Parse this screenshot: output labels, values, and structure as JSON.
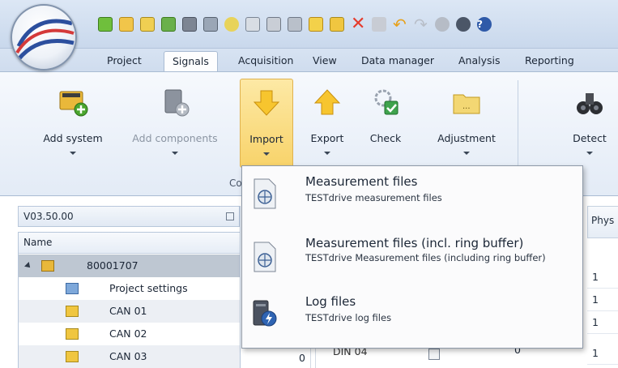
{
  "tabs": [
    "Project",
    "Signals",
    "Acquisition",
    "View",
    "Data manager",
    "Analysis",
    "Reporting"
  ],
  "active_tab": "Signals",
  "ribbon": {
    "add_system": "Add system",
    "add_components": "Add components",
    "import": "Import",
    "export": "Export",
    "check": "Check",
    "adjustment": "Adjustment",
    "detect": "Detect",
    "group_label": "Co"
  },
  "version": "V03.50.00",
  "tree": {
    "header": "Name",
    "rows": [
      {
        "label": "80001707"
      },
      {
        "label": "Project settings"
      },
      {
        "label": "CAN 01"
      },
      {
        "label": "CAN 02"
      },
      {
        "label": "CAN 03"
      }
    ]
  },
  "grid": {
    "phys_header": "Phys",
    "values": [
      "1",
      "1",
      "1",
      "1"
    ],
    "last_row": {
      "count": "0",
      "name": "DIN 04",
      "value": "0"
    }
  },
  "import_menu": {
    "items": [
      {
        "title": "Measurement files",
        "subtitle": "TESTdrive measurement files"
      },
      {
        "title": "Measurement files (incl. ring buffer)",
        "subtitle": "TESTdrive Measurement files (including ring buffer)"
      },
      {
        "title": "Log files",
        "subtitle": "TESTdrive log files"
      }
    ]
  },
  "colors": {
    "accent_pressed": "#f8d36a",
    "selection": "#bec7d2",
    "ribbon_bg": "#e3ebf6"
  }
}
